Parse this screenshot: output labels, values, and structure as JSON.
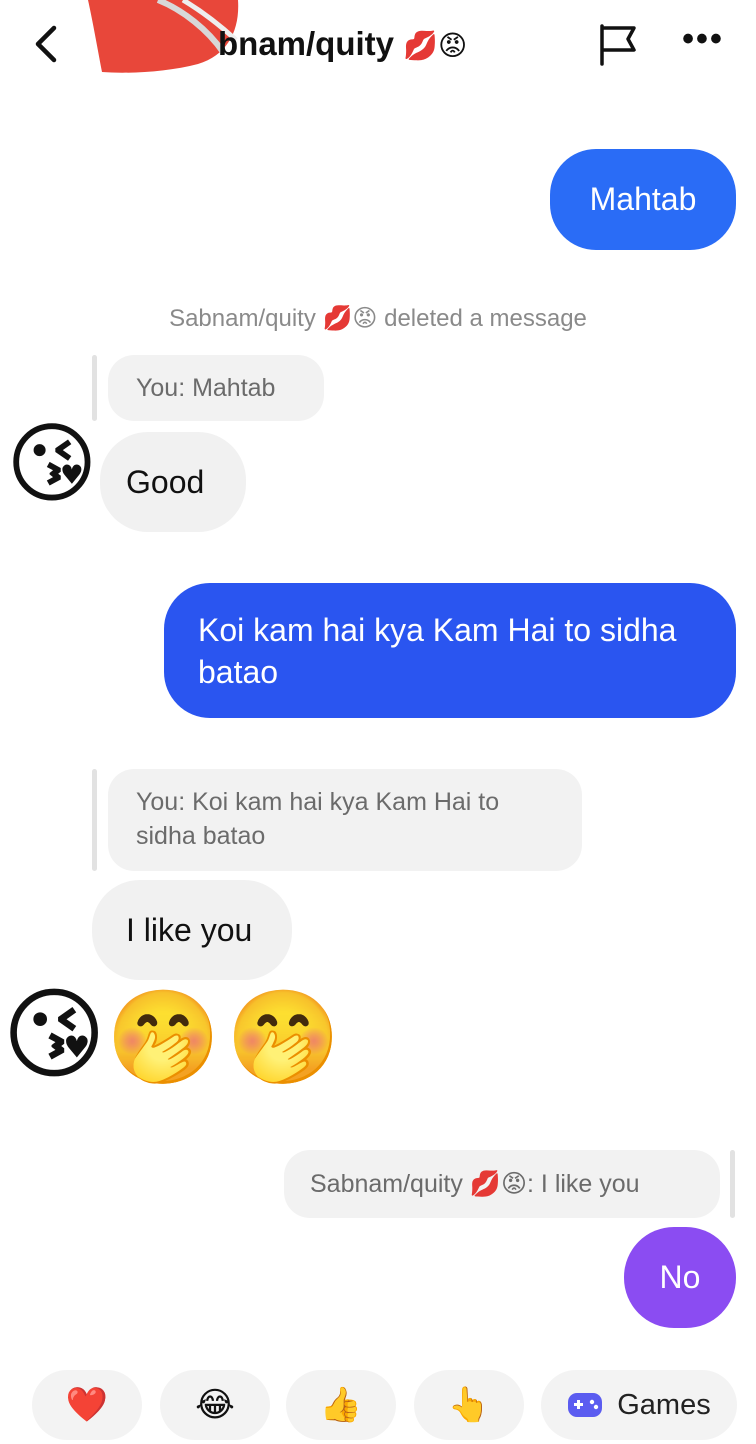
{
  "header": {
    "title": "bnam/quity",
    "title_emojis": "💋😡",
    "back_icon": "chevron-left-icon",
    "flag_icon": "flag-icon",
    "more_icon": "more-horizontal-icon",
    "more_glyph": "•••"
  },
  "messages": {
    "out_1": "Mahtab",
    "system_name": "Sabnam/quity",
    "system_emojis": "💋😡",
    "system_text": "deleted a message",
    "reply_1": "You: Mahtab",
    "in_1": "Good",
    "avatar_emoji": "😘",
    "out_2": "Koi kam hai kya Kam Hai to sidha batao",
    "reply_2": "You: Koi kam hai kya Kam Hai to sidha batao",
    "in_2": "I like you",
    "emoji_1": "😘",
    "emoji_2": "🤭",
    "emoji_3": "🤭",
    "reply_3_name": "Sabnam/quity",
    "reply_3_emojis": "💋😡",
    "reply_3_text": ": I like you",
    "out_3": "No"
  },
  "quick_replies": {
    "heart": "❤️",
    "laugh": "😂",
    "thumbs_up": "👍",
    "point": "👆",
    "games_label": "Games"
  },
  "colors": {
    "bubble_out_1": "#2a6cf6",
    "bubble_out_2": "#2a55f0",
    "bubble_out_3": "#8b4cf2",
    "bubble_in": "#f1f1f1",
    "games_icon": "#5b5cf0",
    "scribble": "#e8473a"
  }
}
